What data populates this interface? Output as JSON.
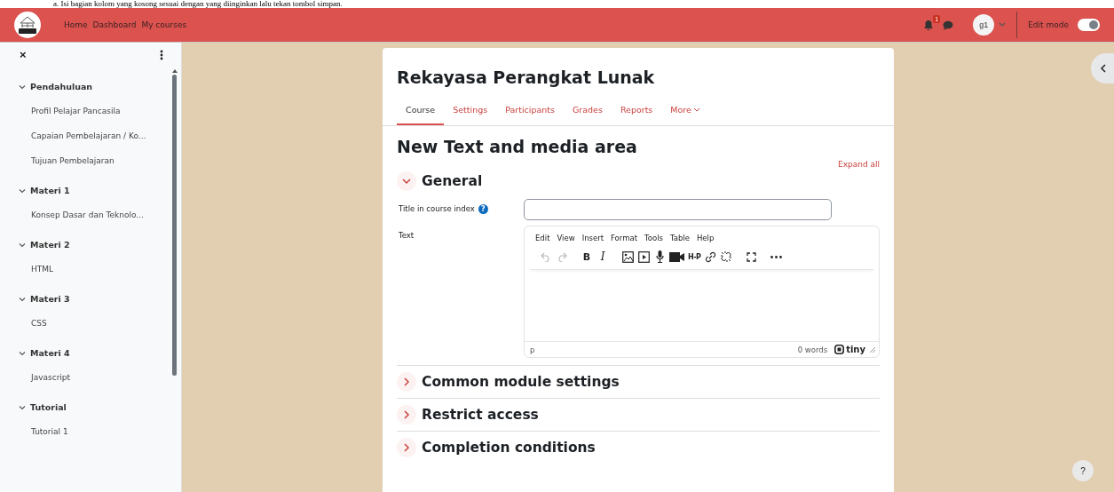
{
  "document_caption": "a.    Isi bagian kolom yang kosong sesuai dengan yang diinginkan lalu tekan tombol simpan.",
  "navbar": {
    "links": [
      {
        "label": "Home"
      },
      {
        "label": "Dashboard"
      },
      {
        "label": "My courses"
      }
    ],
    "notification_count": "1",
    "avatar_initials": "g1",
    "edit_mode": {
      "label": "Edit mode",
      "on": true
    }
  },
  "course_index": {
    "close_button": "×",
    "sections": [
      {
        "label": "Pendahuluan",
        "expanded": true,
        "children": [
          {
            "label": "Profil Pelajar Pancasila"
          },
          {
            "label": "Capaian Pembelajaran / Ko..."
          },
          {
            "label": "Tujuan Pembelajaran"
          }
        ]
      },
      {
        "label": "Materi 1",
        "expanded": true,
        "children": [
          {
            "label": "Konsep Dasar dan Teknolo..."
          }
        ]
      },
      {
        "label": "Materi 2",
        "expanded": true,
        "children": [
          {
            "label": "HTML"
          }
        ]
      },
      {
        "label": "Materi 3",
        "expanded": true,
        "children": [
          {
            "label": "CSS"
          }
        ]
      },
      {
        "label": "Materi 4",
        "expanded": true,
        "children": [
          {
            "label": "Javascript"
          }
        ]
      },
      {
        "label": "Tutorial",
        "expanded": true,
        "children": [
          {
            "label": "Tutorial 1"
          }
        ]
      }
    ]
  },
  "course": {
    "title": "Rekayasa Perangkat Lunak",
    "tabs": [
      {
        "label": "Course",
        "selected": true
      },
      {
        "label": "Settings",
        "selected": false
      },
      {
        "label": "Participants",
        "selected": false
      },
      {
        "label": "Grades",
        "selected": false
      },
      {
        "label": "Reports",
        "selected": false
      },
      {
        "label": "More",
        "selected": false,
        "dropdown": true
      }
    ]
  },
  "form": {
    "heading": "New Text and media area",
    "expand_all": "Expand all",
    "sections": [
      {
        "title": "General",
        "expanded": true,
        "fields": [
          {
            "kind": "input",
            "label": "Title in course index",
            "help": "?"
          },
          {
            "kind": "editor",
            "label": "Text"
          }
        ]
      },
      {
        "title": "Common module settings",
        "expanded": false
      },
      {
        "title": "Restrict access",
        "expanded": false
      },
      {
        "title": "Completion conditions",
        "expanded": false
      }
    ]
  },
  "editor": {
    "menu": [
      {
        "label": "Edit"
      },
      {
        "label": "View"
      },
      {
        "label": "Insert"
      },
      {
        "label": "Format"
      },
      {
        "label": "Tools"
      },
      {
        "label": "Table"
      },
      {
        "label": "Help"
      }
    ],
    "toolbar": [
      [
        {
          "kind": "undo",
          "disabled": true
        },
        {
          "kind": "redo",
          "disabled": true
        }
      ],
      [
        {
          "kind": "bold",
          "label": "B"
        },
        {
          "kind": "italic",
          "label": "I"
        }
      ],
      [
        {
          "kind": "image"
        },
        {
          "kind": "media"
        },
        {
          "kind": "microphone"
        },
        {
          "kind": "video"
        },
        {
          "kind": "h5p",
          "label": "H-P"
        },
        {
          "kind": "link"
        },
        {
          "kind": "unlink"
        }
      ],
      [
        {
          "kind": "fullscreen"
        }
      ],
      [
        {
          "kind": "more"
        }
      ]
    ],
    "path": "p",
    "word_count": "0 words",
    "brand": "tiny"
  },
  "help_button": "?"
}
